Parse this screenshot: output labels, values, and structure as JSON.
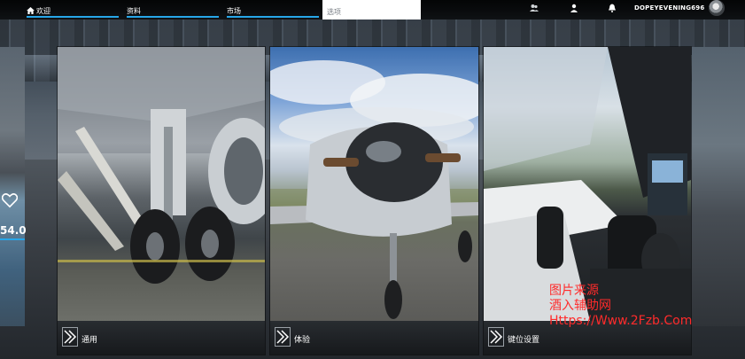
{
  "nav": {
    "tabs": [
      {
        "label": "欢迎",
        "active": true,
        "icon": "home-icon"
      },
      {
        "label": "资料",
        "active": false
      },
      {
        "label": "市场",
        "active": false
      }
    ],
    "search_label": "选项"
  },
  "header": {
    "icons": [
      "friends-icon",
      "profile-icon",
      "notifications-icon"
    ],
    "username": "DOPEYEVENING696",
    "avatar_icon": "avatar-icon"
  },
  "left_peek": {
    "favorite_icon": "heart-icon",
    "price": "54.0"
  },
  "cards": [
    {
      "label": "通用",
      "icon": "chevron-right-icon",
      "image": "landing-gear-closeup"
    },
    {
      "label": "体验",
      "icon": "chevron-right-icon",
      "image": "propeller-plane-nose"
    },
    {
      "label": "键位设置",
      "icon": "chevron-right-icon",
      "image": "cockpit-yoke"
    }
  ],
  "watermark": {
    "line1": "图片来源",
    "line2": "酒入辅助网",
    "line3": "Https://Www.2Fzb.Com"
  },
  "colors": {
    "accent": "#27a6e8",
    "watermark": "#ff2b2b"
  }
}
